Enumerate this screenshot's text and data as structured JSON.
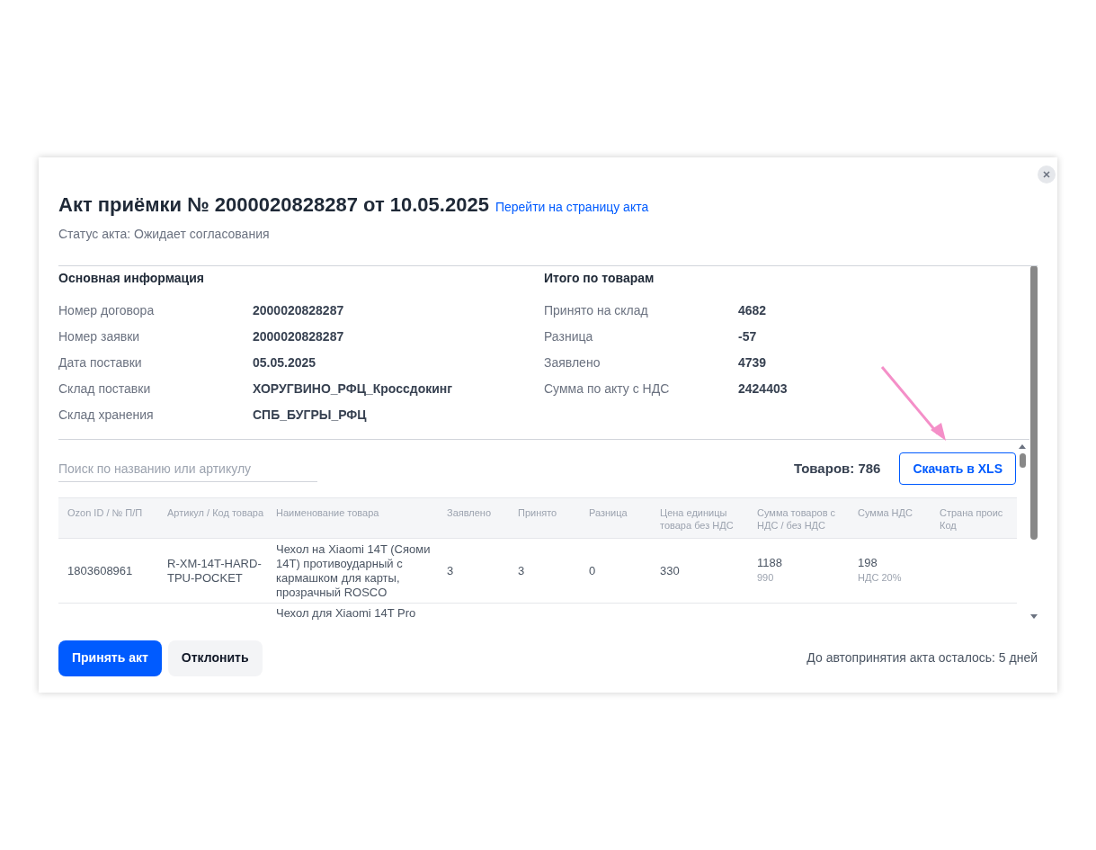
{
  "dialog": {
    "title": "Акт приёмки № 2000020828287 от 10.05.2025",
    "title_link": "Перейти на страницу акта",
    "status": "Статус акта: Ожидает согласования"
  },
  "info": {
    "title": "Основная информация",
    "rows": [
      {
        "label": "Номер договора",
        "value": "2000020828287"
      },
      {
        "label": "Номер заявки",
        "value": "2000020828287"
      },
      {
        "label": "Дата поставки",
        "value": "05.05.2025"
      },
      {
        "label": "Склад поставки",
        "value": "ХОРУГВИНО_РФЦ_Кроссдокинг"
      },
      {
        "label": "Склад хранения",
        "value": "СПБ_БУГРЫ_РФЦ"
      }
    ]
  },
  "totals": {
    "title": "Итого по товарам",
    "rows": [
      {
        "label": "Принято на склад",
        "value": "4682"
      },
      {
        "label": "Разница",
        "value": "-57"
      },
      {
        "label": "Заявлено",
        "value": "4739"
      },
      {
        "label": "Сумма по акту с НДС",
        "value": "2424403"
      }
    ]
  },
  "products": {
    "search": {
      "placeholder": "Поиск по названию или артикулу"
    },
    "count": "Товаров: 786",
    "download_button": "Скачать в XLS",
    "table": {
      "columns": [
        "Ozon ID / № П/П",
        "Артикул / Код товара",
        "Наименование товара",
        "Заявлено",
        "Принято",
        "Разница",
        "Цена единицы товара без НДС",
        "Сумма товаров с НДС / без НДС",
        "Сумма НДС",
        "Страна проис Код"
      ],
      "rows": [
        {
          "cells": [
            {
              "text": "1803608961"
            },
            {
              "text": "R-XM-14T-HARD-TPU-POCKET"
            },
            {
              "text": "Чехол на Xiaomi 14T (Сяоми 14T) противоударный с кармашком для карты, прозрачный ROSCO"
            },
            {
              "text": "3"
            },
            {
              "text": "3"
            },
            {
              "text": "0"
            },
            {
              "text": "330"
            },
            {
              "text": "1188",
              "sub": "990"
            },
            {
              "text": "198",
              "sub": "НДС 20%"
            },
            {
              "text": ""
            }
          ]
        },
        {
          "cells": [
            {
              "text": ""
            },
            {
              "text": ""
            },
            {
              "text": "Чехол для Xiaomi 14T Pro"
            }
          ]
        }
      ]
    }
  },
  "footer": {
    "accept_button": "Принять акт",
    "reject_button": "Отклонить",
    "note": "До автопринятия акта осталось: 5 дней"
  }
}
